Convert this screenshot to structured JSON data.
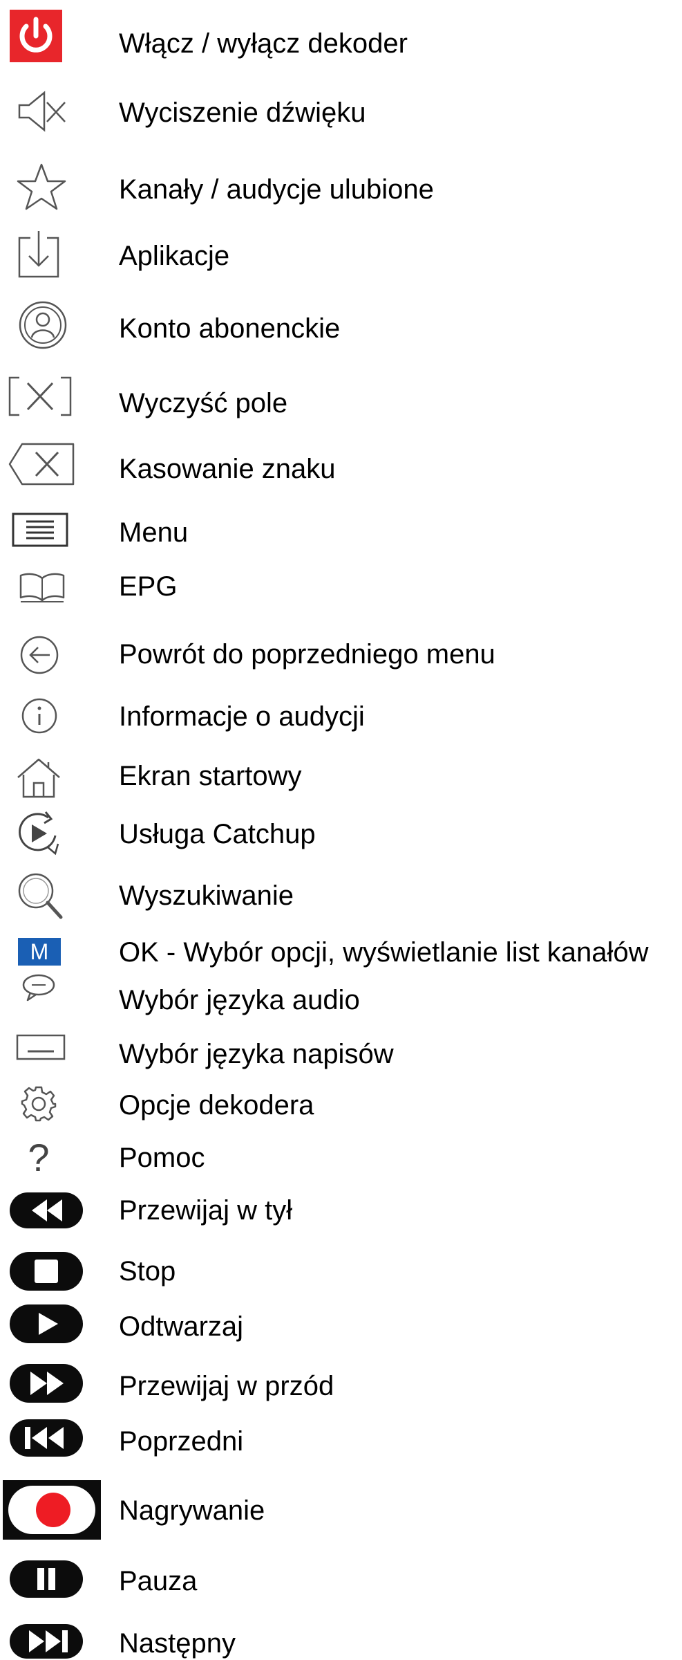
{
  "legend": {
    "items": [
      {
        "label": "Włącz / wyłącz dekoder",
        "icon": "power-icon"
      },
      {
        "label": "Wyciszenie dźwięku",
        "icon": "mute-icon"
      },
      {
        "label": "Kanały / audycje ulubione",
        "icon": "star-icon"
      },
      {
        "label": "Aplikacje",
        "icon": "apps-download-icon"
      },
      {
        "label": "Konto abonenckie",
        "icon": "account-icon"
      },
      {
        "label": "Wyczyść pole",
        "icon": "clear-field-icon"
      },
      {
        "label": "Kasowanie znaku",
        "icon": "backspace-icon"
      },
      {
        "label": "Menu",
        "icon": "menu-icon"
      },
      {
        "label": "EPG",
        "icon": "epg-book-icon"
      },
      {
        "label": "Powrót do poprzedniego menu",
        "icon": "back-arrow-icon"
      },
      {
        "label": "Informacje o audycji",
        "icon": "info-icon"
      },
      {
        "label": "Ekran startowy",
        "icon": "home-icon"
      },
      {
        "label": "Usługa Catchup",
        "icon": "catchup-icon"
      },
      {
        "label": "Wyszukiwanie",
        "icon": "search-icon"
      },
      {
        "label": "OK - Wybór opcji, wyświetlanie list kanałów",
        "icon": "ok-m-icon",
        "icon_text": "M"
      },
      {
        "label": "Wybór języka audio",
        "icon": "speech-bubble-icon"
      },
      {
        "label": "Wybór języka napisów",
        "icon": "subtitles-icon"
      },
      {
        "label": "Opcje dekodera",
        "icon": "gear-icon"
      },
      {
        "label": "Pomoc",
        "icon": "help-icon",
        "icon_text": "?"
      },
      {
        "label": "Przewijaj w tył",
        "icon": "rewind-icon"
      },
      {
        "label": "Stop",
        "icon": "stop-icon"
      },
      {
        "label": "Odtwarzaj",
        "icon": "play-icon"
      },
      {
        "label": "Przewijaj w przód",
        "icon": "fast-forward-icon"
      },
      {
        "label": "Poprzedni",
        "icon": "previous-icon"
      },
      {
        "label": "Nagrywanie",
        "icon": "record-icon"
      },
      {
        "label": "Pauza",
        "icon": "pause-icon"
      },
      {
        "label": "Następny",
        "icon": "next-icon"
      }
    ]
  },
  "colors": {
    "power_red": "#e8262b",
    "record_red": "#ee1c24",
    "ok_blue": "#1a5fb4",
    "icon_gray": "#555555",
    "pill_black": "#0c0c0c"
  }
}
